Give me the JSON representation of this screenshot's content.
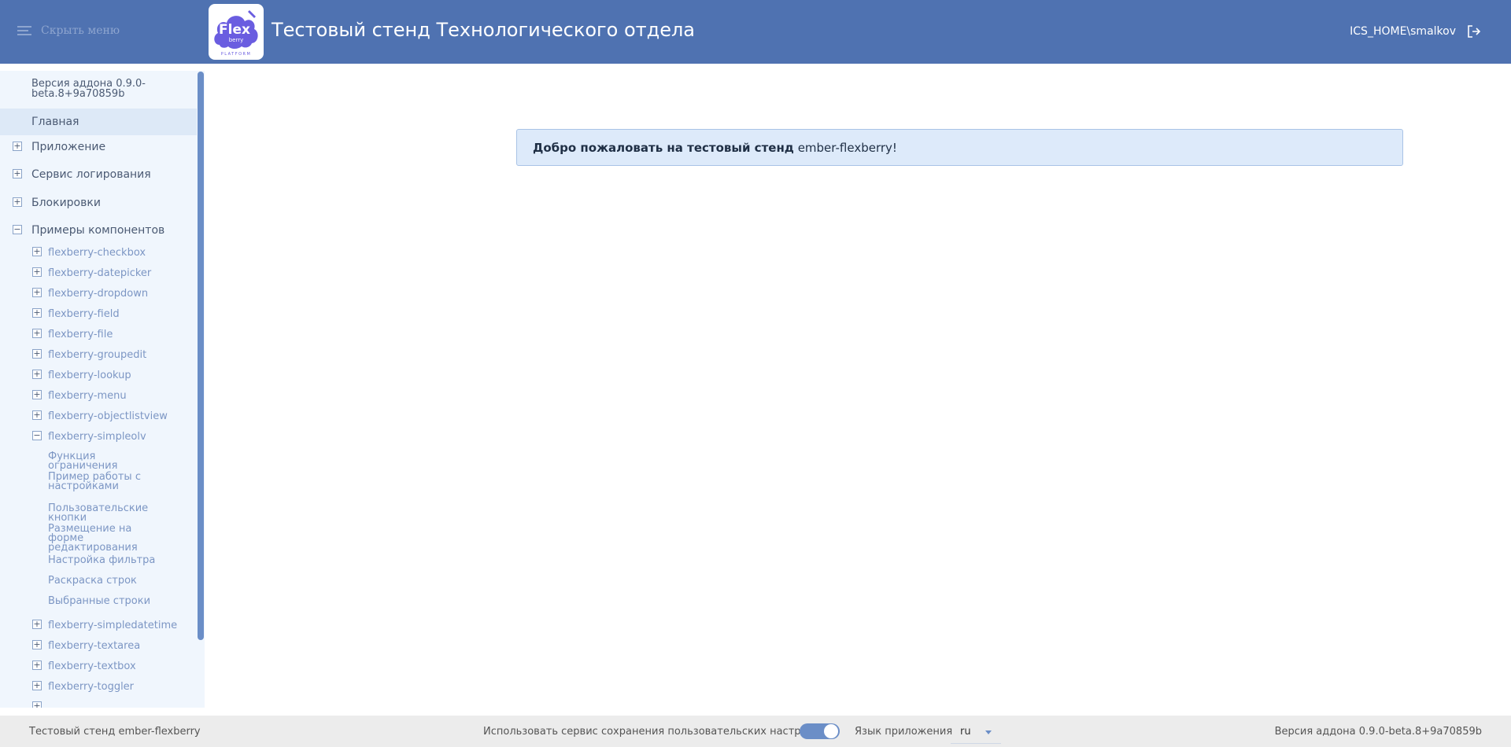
{
  "header": {
    "menu_toggle_label": "Скрыть меню",
    "logo_text": "Flex",
    "logo_subtext": "berry",
    "logo_platform": "PLATFORM",
    "title": "Тестовый стенд Технологического отдела",
    "user": "ICS_HOME\\smalkov",
    "logout_icon": "logout-icon"
  },
  "sidebar": {
    "version": "Версия аддона 0.9.0-beta.8+9a70859b",
    "home": "Главная",
    "sections": [
      {
        "label": "Приложение",
        "expanded": false
      },
      {
        "label": "Сервис логирования",
        "expanded": false
      },
      {
        "label": "Блокировки",
        "expanded": false
      },
      {
        "label": "Примеры компонентов",
        "expanded": true
      }
    ],
    "components": [
      {
        "label": "flexberry-checkbox",
        "expanded": false
      },
      {
        "label": "flexberry-datepicker",
        "expanded": false
      },
      {
        "label": "flexberry-dropdown",
        "expanded": false
      },
      {
        "label": "flexberry-field",
        "expanded": false
      },
      {
        "label": "flexberry-file",
        "expanded": false
      },
      {
        "label": "flexberry-groupedit",
        "expanded": false
      },
      {
        "label": "flexberry-lookup",
        "expanded": false
      },
      {
        "label": "flexberry-menu",
        "expanded": false
      },
      {
        "label": "flexberry-objectlistview",
        "expanded": false
      },
      {
        "label": "flexberry-simpleolv",
        "expanded": true
      }
    ],
    "simpleolv_items": [
      "Функция ограничения",
      "Пример работы с настройками",
      "Пользовательские кнопки",
      "Размещение на форме редактирования",
      "Настройка фильтра",
      "Раскраска строк",
      "Выбранные строки"
    ],
    "components_after": [
      {
        "label": "flexberry-simpledatetime",
        "expanded": false
      },
      {
        "label": "flexberry-textarea",
        "expanded": false
      },
      {
        "label": "flexberry-textbox",
        "expanded": false
      },
      {
        "label": "flexberry-toggler",
        "expanded": false
      }
    ]
  },
  "main": {
    "welcome_bold": "Добро пожаловать на тестовый стенд",
    "welcome_rest": " ember-flexberry!"
  },
  "footer": {
    "app_name": "Тестовый стенд ember-flexberry",
    "settings_label": "Использовать сервис сохранения пользовательских настроек",
    "settings_enabled": true,
    "language_label": "Язык приложения",
    "language_value": "ru",
    "version": "Версия аддона 0.9.0-beta.8+9a70859b"
  },
  "colors": {
    "header": "#4f72b1",
    "sidebar": "#f0f6fd",
    "accent": "#6b8ec7",
    "welcome_bg": "#ddeafa"
  }
}
